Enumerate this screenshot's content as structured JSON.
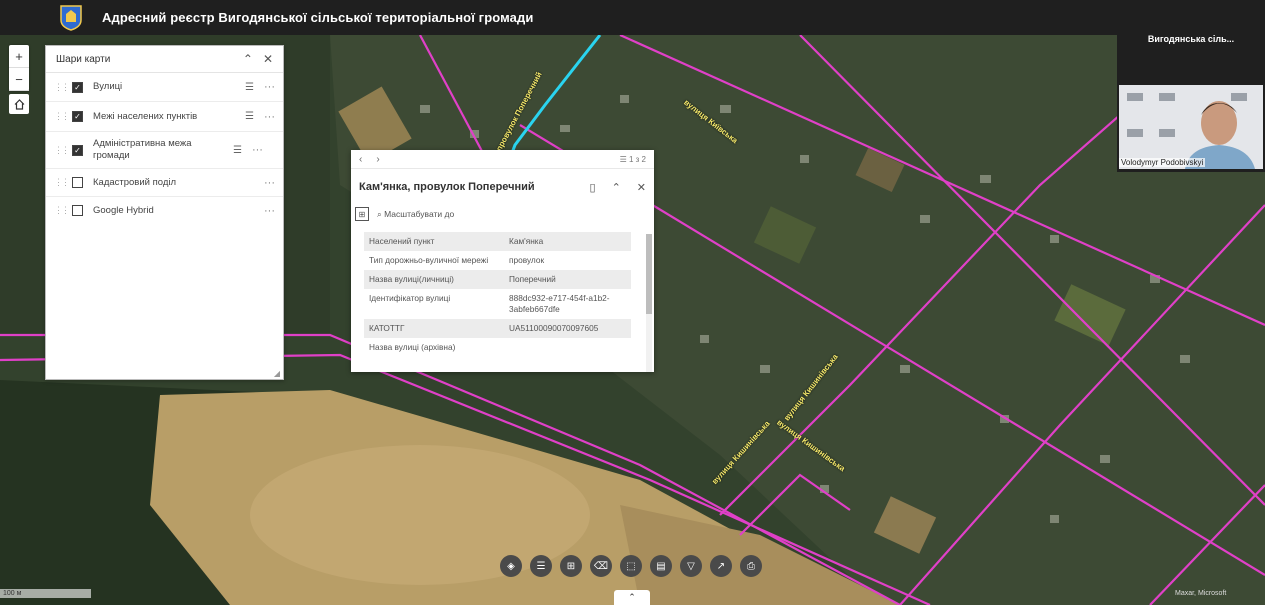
{
  "header": {
    "title": "Адресний реєстр Вигодянської сільської територіальної громади"
  },
  "zoom": {
    "in": "+",
    "out": "−"
  },
  "layers": {
    "title": "Шари карти",
    "items": [
      {
        "label": "Вулиці",
        "checked": true,
        "has_legend": true
      },
      {
        "label": "Межі населених пунктів",
        "checked": true,
        "has_legend": true
      },
      {
        "label": "Адміністративна межа громади",
        "checked": true,
        "has_legend": true
      },
      {
        "label": "Кадастровий поділ",
        "checked": false,
        "has_legend": false
      },
      {
        "label": "Google Hybrid",
        "checked": false,
        "has_legend": false
      }
    ]
  },
  "popup": {
    "counter": "1 з 2",
    "title": "Кам'янка, провулок Поперечний",
    "zoom_to": "Масштабувати до",
    "rows": [
      {
        "k": "Населений пункт",
        "v": "Кам'янка"
      },
      {
        "k": "Тип дорожньо-вуличної мережі",
        "v": "провулок"
      },
      {
        "k": "Назва вулиці(личниці)",
        "v": "Поперечний"
      },
      {
        "k": "Ідентифікатор вулиці",
        "v": "888dc932-e717-454f-a1b2-3abfeb667dfe"
      },
      {
        "k": "КАТОТТГ",
        "v": "UA51100090070097605"
      },
      {
        "k": "Назва вулиці (архівна)",
        "v": ""
      }
    ]
  },
  "streets": [
    {
      "label": "вулиця Київська"
    },
    {
      "label": "провулок Поперечний"
    },
    {
      "label": "вулиця Кишинівська"
    },
    {
      "label": "вулиця Кишинівська"
    },
    {
      "label": "вулиця Кишинівська"
    }
  ],
  "map": {
    "scale_label": "100 м",
    "attribution": "Maxar, Microsoft"
  },
  "video": {
    "title": "Вигодянська сіль...",
    "name": "Volodymyr Podobivskyi"
  },
  "colors": {
    "street_line": "#e040c8",
    "highlight": "#2ad4f0",
    "header_bg": "#1f1f1f"
  }
}
